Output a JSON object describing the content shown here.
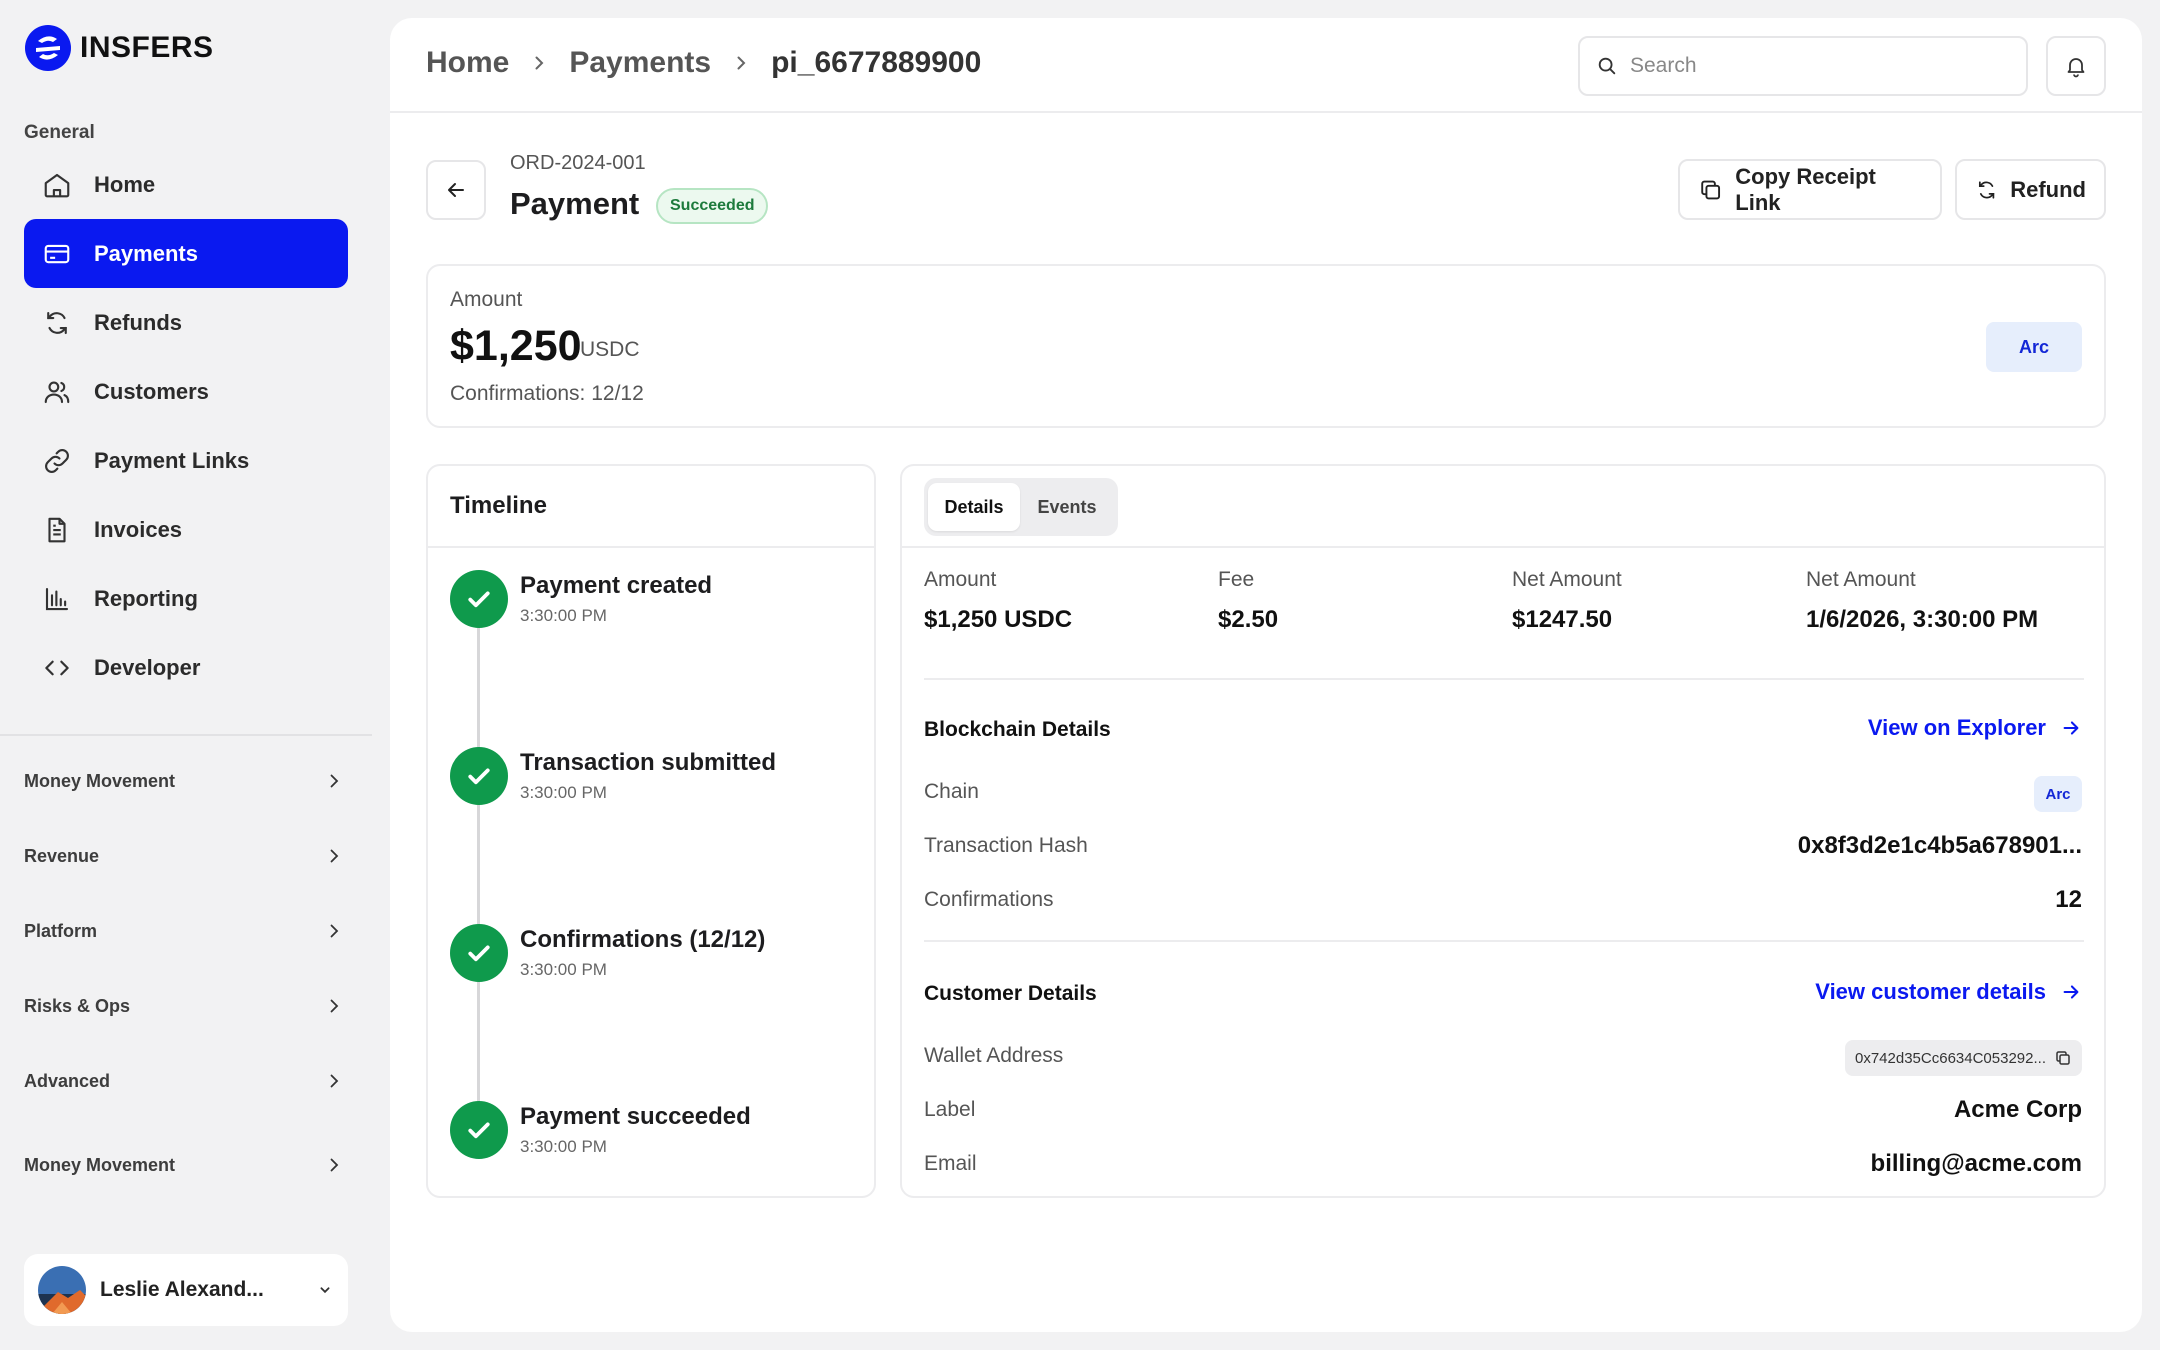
{
  "brand": {
    "name": "INSFERS"
  },
  "sidebar": {
    "group_title": "General",
    "items": [
      {
        "label": "Home",
        "icon": "home-icon"
      },
      {
        "label": "Payments",
        "icon": "card-icon",
        "active": true
      },
      {
        "label": "Refunds",
        "icon": "refresh-icon"
      },
      {
        "label": "Customers",
        "icon": "users-icon"
      },
      {
        "label": "Payment Links",
        "icon": "link-icon"
      },
      {
        "label": "Invoices",
        "icon": "document-icon"
      },
      {
        "label": "Reporting",
        "icon": "bar-chart-icon"
      },
      {
        "label": "Developer",
        "icon": "code-icon"
      }
    ],
    "sections": [
      {
        "label": "Money Movement"
      },
      {
        "label": "Revenue"
      },
      {
        "label": "Platform"
      },
      {
        "label": "Risks & Ops"
      },
      {
        "label": "Advanced"
      },
      {
        "label": "Money Movement"
      }
    ],
    "user": {
      "name": "Leslie Alexand..."
    }
  },
  "header": {
    "breadcrumbs": [
      "Home",
      "Payments",
      "pi_6677889900"
    ],
    "search": {
      "placeholder": "Search"
    }
  },
  "payment": {
    "order_id": "ORD-2024-001",
    "title": "Payment",
    "status": "Succeeded",
    "actions": {
      "copy_label": "Copy Receipt Link",
      "refund_label": "Refund"
    },
    "amount_label": "Amount",
    "amount_value": "$1,250",
    "currency": "USDC",
    "confirmations": "Confirmations: 12/12",
    "chain_badge": "Arc"
  },
  "timeline": {
    "title": "Timeline",
    "events": [
      {
        "title": "Payment created",
        "time": "3:30:00 PM"
      },
      {
        "title": "Transaction submitted",
        "time": "3:30:00 PM"
      },
      {
        "title": "Confirmations (12/12)",
        "time": "3:30:00 PM"
      },
      {
        "title": "Payment succeeded",
        "time": "3:30:00 PM"
      }
    ]
  },
  "details": {
    "tabs": [
      "Details",
      "Events"
    ],
    "summary": [
      {
        "label": "Amount",
        "value": "$1,250 USDC"
      },
      {
        "label": "Fee",
        "value": "$2.50"
      },
      {
        "label": "Net Amount",
        "value": "$1247.50"
      },
      {
        "label": "Net Amount",
        "value": "1/6/2026, 3:30:00 PM"
      }
    ],
    "blockchain": {
      "title": "Blockchain Details",
      "link": "View on Explorer",
      "chain_label": "Chain",
      "chain_value": "Arc",
      "hash_label": "Transaction Hash",
      "hash_value": "0x8f3d2e1c4b5a678901...",
      "conf_label": "Confirmations",
      "conf_value": "12"
    },
    "customer": {
      "title": "Customer Details",
      "link": "View customer details",
      "wallet_label": "Wallet Address",
      "wallet_value": "0x742d35Cc6634C053292...",
      "label_label": "Label",
      "label_value": "Acme Corp",
      "email_label": "Email",
      "email_value": "billing@acme.com"
    }
  },
  "colors": {
    "accent": "#0a19f0",
    "success": "#0f9a4c",
    "chain_badge_bg": "#e6eefc"
  }
}
